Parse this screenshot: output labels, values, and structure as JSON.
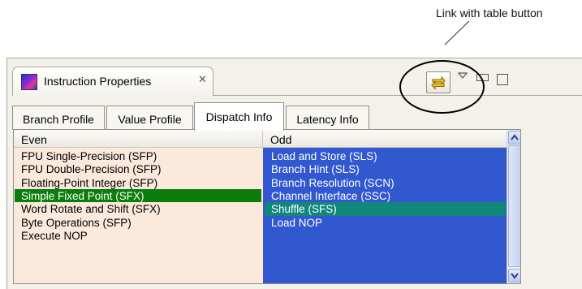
{
  "annotation": {
    "label": "Link with table button"
  },
  "view": {
    "title": "Instruction Properties",
    "close_glyph": "✕",
    "icon": "instruction-properties-icon"
  },
  "toolbar": {
    "link_button_icon": "link-with-table-icon",
    "menu_icon": "view-menu-chevron-icon",
    "minimize_icon": "minimize-icon",
    "maximize_icon": "maximize-icon"
  },
  "tabs": [
    {
      "label": "Branch Profile",
      "active": false
    },
    {
      "label": "Value Profile",
      "active": false
    },
    {
      "label": "Dispatch Info",
      "active": true
    },
    {
      "label": "Latency Info",
      "active": false
    }
  ],
  "table": {
    "columns": [
      "Even",
      "Odd"
    ],
    "rows": [
      {
        "even": "FPU Single-Precision (SFP)",
        "odd": "Load and Store (SLS)"
      },
      {
        "even": "FPU Double-Precision (SFP)",
        "odd": "Branch Hint (SLS)"
      },
      {
        "even": "Floating-Point Integer (SFP)",
        "odd": "Branch Resolution (SCN)"
      },
      {
        "even": "Simple Fixed Point (SFX)",
        "odd": "Channel Interface (SSC)",
        "even_selected": true
      },
      {
        "even": "Word Rotate and Shift (SFX)",
        "odd": "Shuffle (SFS)",
        "odd_selected": true
      },
      {
        "even": "Byte Operations (SFP)",
        "odd": "Load NOP"
      },
      {
        "even": "Execute NOP",
        "odd": ""
      }
    ]
  },
  "colors": {
    "even_bg": "#fbe9dc",
    "odd_bg": "#3158cf",
    "even_selected": "#0a7d0a",
    "odd_selected": "#11867a"
  }
}
